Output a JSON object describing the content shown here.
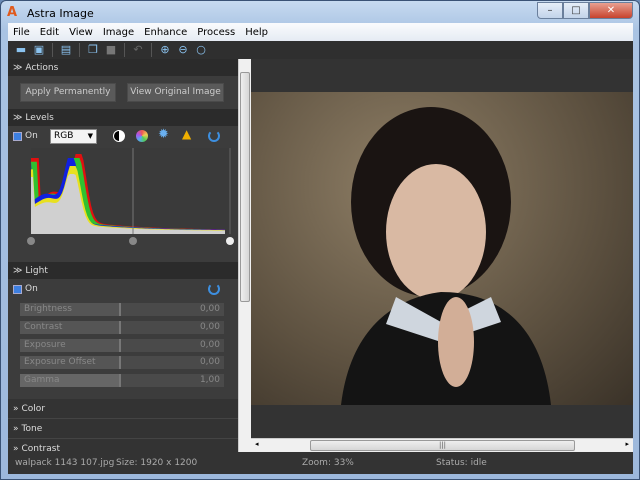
{
  "window": {
    "title": "Astra Image",
    "minimize": "–",
    "maximize": "□",
    "close": "✕"
  },
  "menu": [
    "File",
    "Edit",
    "View",
    "Image",
    "Enhance",
    "Process",
    "Help"
  ],
  "toolbar": [
    "open",
    "save",
    "print",
    "copy",
    "paste",
    "undo",
    "zoom-in",
    "zoom-out",
    "zoom-fit"
  ],
  "actions": {
    "header": "Actions",
    "apply": "Apply Permanently",
    "view_original": "View Original Image"
  },
  "levels": {
    "header": "Levels",
    "on_label": "On",
    "on": true,
    "channel": "RGB"
  },
  "light": {
    "header": "Light",
    "on_label": "On",
    "on": true,
    "sliders": [
      {
        "label": "Brightness",
        "value": "0,00"
      },
      {
        "label": "Contrast",
        "value": "0,00"
      },
      {
        "label": "Exposure",
        "value": "0,00"
      },
      {
        "label": "Exposure Offset",
        "value": "0,00"
      },
      {
        "label": "Gamma",
        "value": "1,00"
      }
    ]
  },
  "collapsed": [
    "Color",
    "Tone",
    "Contrast"
  ],
  "status": {
    "file": "walpack 1143 107.jpg",
    "size": "Size: 1920 x 1200",
    "zoom": "Zoom: 33%",
    "state": "Status: idle"
  },
  "colors": {
    "accent": "#3d7fe0",
    "panel": "#3c3c3c"
  }
}
